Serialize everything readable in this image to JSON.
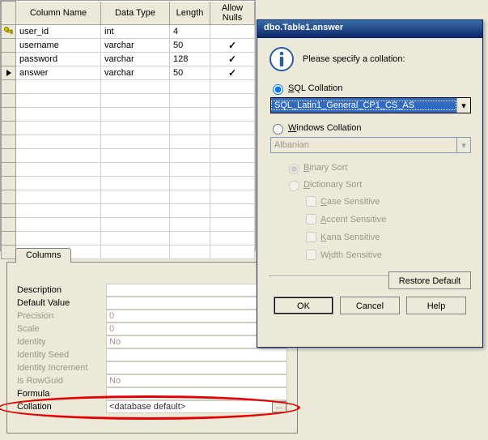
{
  "grid": {
    "headers": {
      "name": "Column Name",
      "type": "Data Type",
      "length": "Length",
      "nulls": "Allow Nulls"
    },
    "rows": [
      {
        "marker": "key",
        "name": "user_id",
        "type": "int",
        "length": "4",
        "nulls": false
      },
      {
        "marker": "",
        "name": "username",
        "type": "varchar",
        "length": "50",
        "nulls": true
      },
      {
        "marker": "",
        "name": "password",
        "type": "varchar",
        "length": "128",
        "nulls": true
      },
      {
        "marker": "sel",
        "name": "answer",
        "type": "varchar",
        "length": "50",
        "nulls": true
      }
    ]
  },
  "props": {
    "tab": "Columns",
    "items": [
      {
        "label": "Description",
        "value": "",
        "dimLabel": false,
        "dimValue": false
      },
      {
        "label": "Default Value",
        "value": "",
        "dimLabel": false,
        "dimValue": false
      },
      {
        "label": "Precision",
        "value": "0",
        "dimLabel": true,
        "dimValue": true
      },
      {
        "label": "Scale",
        "value": "0",
        "dimLabel": true,
        "dimValue": true
      },
      {
        "label": "Identity",
        "value": "No",
        "dimLabel": true,
        "dimValue": true
      },
      {
        "label": "Identity Seed",
        "value": "",
        "dimLabel": true,
        "dimValue": true
      },
      {
        "label": "Identity Increment",
        "value": "",
        "dimLabel": true,
        "dimValue": true
      },
      {
        "label": "Is RowGuid",
        "value": "No",
        "dimLabel": true,
        "dimValue": true
      },
      {
        "label": "Formula",
        "value": "",
        "dimLabel": false,
        "dimValue": false
      },
      {
        "label": "Collation",
        "value": "<database default>",
        "dimLabel": false,
        "dimValue": false,
        "button": true
      }
    ]
  },
  "dialog": {
    "title": "dbo.Table1.answer",
    "prompt": "Please specify a collation:",
    "sql": {
      "label": "SQL Collation",
      "value": "SQL_Latin1_General_CP1_CS_AS"
    },
    "win": {
      "label": "Windows Collation",
      "value": "Albanian"
    },
    "binary": "Binary Sort",
    "dict": "Dictionary Sort",
    "opts": {
      "case": "Case Sensitive",
      "accent": "Accent Sensitive",
      "kana": "Kana Sensitive",
      "width": "Width Sensitive"
    },
    "restore": "Restore Default",
    "ok": "OK",
    "cancel": "Cancel",
    "help": "Help"
  }
}
